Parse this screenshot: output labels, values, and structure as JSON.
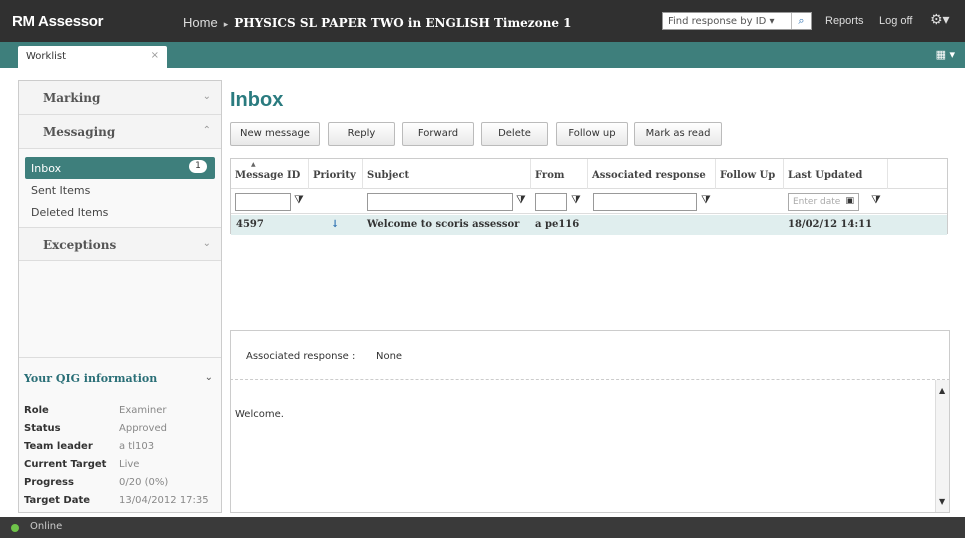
{
  "header": {
    "logo": "RM Assessor",
    "home": "Home",
    "separator": "▸",
    "title": "PHYSICS SL PAPER TWO in ENGLISH Timezone 1",
    "find_placeholder": "Find response by ID ▾",
    "reports": "Reports",
    "logoff": "Log off"
  },
  "tabs": [
    {
      "label": "Worklist",
      "close": "×"
    }
  ],
  "sidebar": {
    "sections": [
      {
        "label": "Marking",
        "chev": "⌄"
      },
      {
        "label": "Messaging",
        "chev": "⌃"
      },
      {
        "label": "Exceptions",
        "chev": "⌄"
      }
    ],
    "items": [
      {
        "label": "Inbox",
        "badge": "1"
      },
      {
        "label": "Sent Items"
      },
      {
        "label": "Deleted Items"
      }
    ],
    "qig": {
      "title": "Your QIG information",
      "rows": [
        {
          "k": "Role",
          "v": "Examiner"
        },
        {
          "k": "Status",
          "v": "Approved"
        },
        {
          "k": "Team leader",
          "v": "a tl103"
        },
        {
          "k": "Current Target",
          "v": "Live"
        },
        {
          "k": "Progress",
          "v": "0/20 (0%)"
        },
        {
          "k": "Target Date",
          "v": "13/04/2012 17:35"
        }
      ]
    }
  },
  "main": {
    "title": "Inbox",
    "buttons": [
      "New message",
      "Reply",
      "Forward",
      "Delete",
      "Follow up",
      "Mark as read"
    ],
    "columns": [
      "Message ID",
      "Priority",
      "Subject",
      "From",
      "Associated response",
      "Follow Up",
      "Last Updated"
    ],
    "date_placeholder": "Enter date",
    "rows": [
      {
        "id": "4597",
        "priority": "↓",
        "subject": "Welcome to scoris assessor",
        "from": "a pe116",
        "assoc": "",
        "follow": "",
        "updated": "18/02/12 14:11"
      }
    ],
    "assoc_label": "Associated response :",
    "assoc_value": "None",
    "body": "Welcome."
  },
  "status": {
    "text": "Online"
  },
  "colors": {
    "accent": "#3e7f7c",
    "title": "#2a7b7f",
    "topbar": "#303030",
    "online": "#6fc34a"
  }
}
